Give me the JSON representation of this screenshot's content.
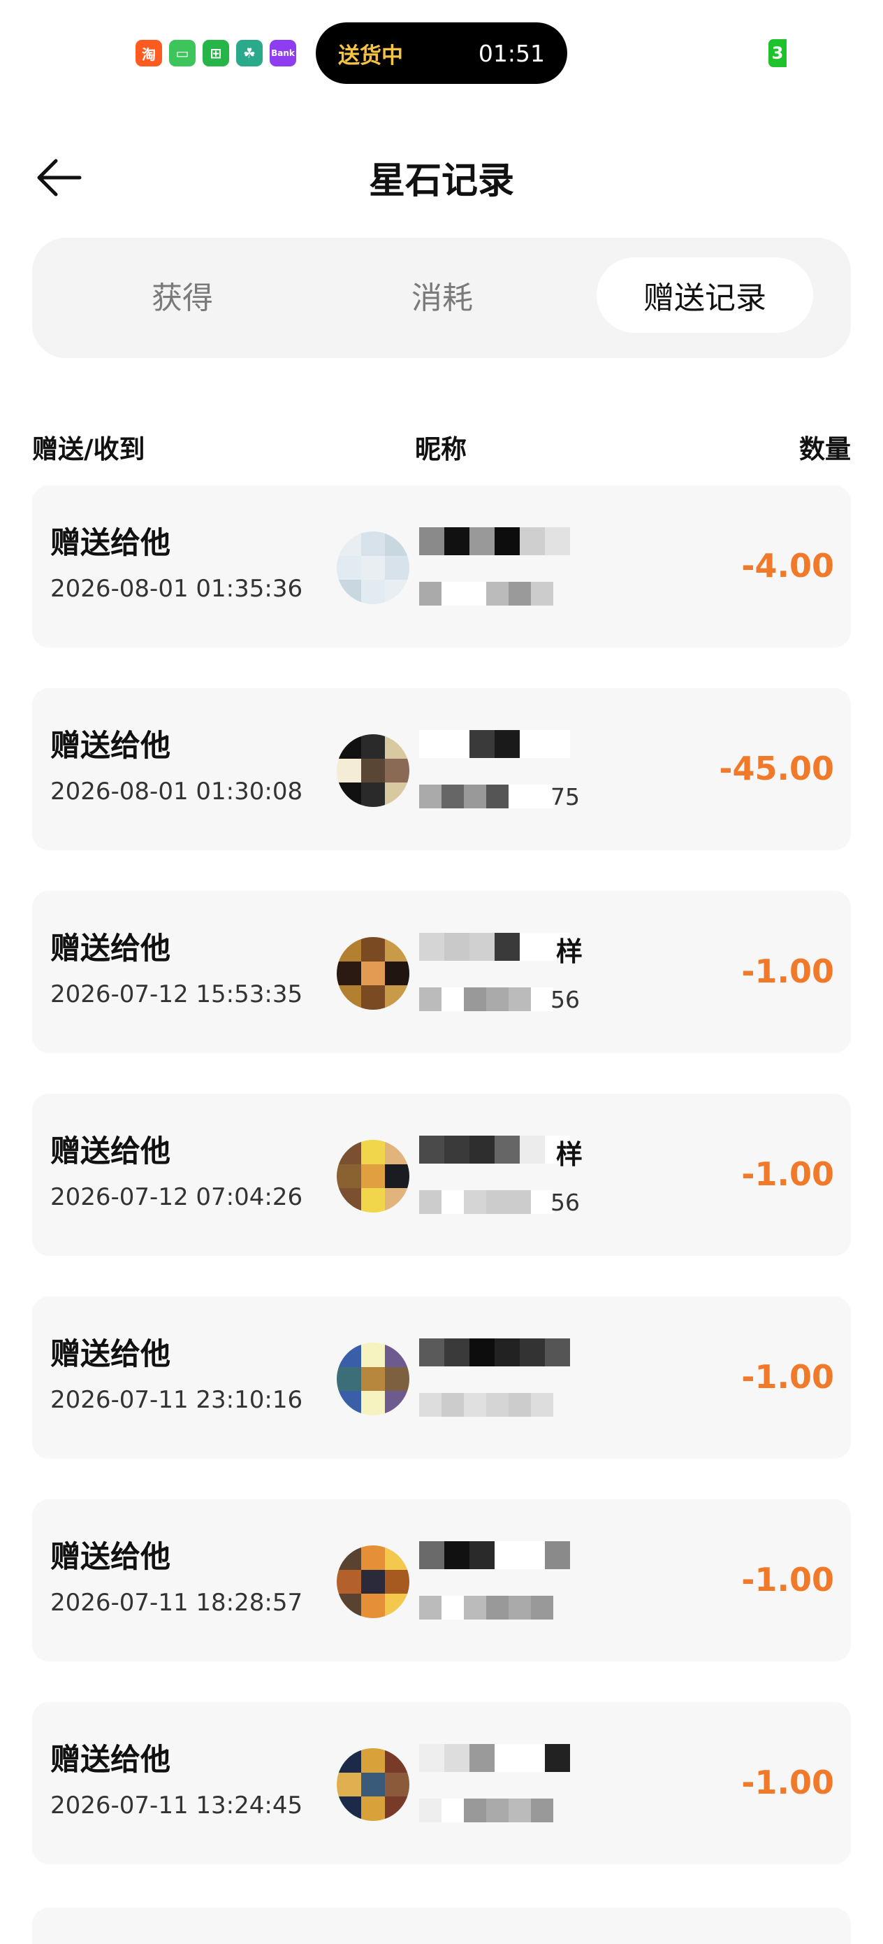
{
  "status_bar": {
    "app_icons": [
      {
        "glyph": "淘",
        "name": "taobao",
        "color": "#ff5a1f"
      },
      {
        "glyph": "▭",
        "name": "messages",
        "color": "#3dc45a"
      },
      {
        "glyph": "⊞",
        "name": "wallet",
        "color": "#26b548"
      },
      {
        "glyph": "☘",
        "name": "bank",
        "color": "#2aa98b"
      },
      {
        "glyph": "Bank",
        "name": "bank-app",
        "color": "#8e3df0"
      }
    ],
    "island_status": "送货中",
    "island_time": "01:51",
    "battery": "3",
    "colors": {
      "island_text": "#f6c445",
      "battery": "#1ec22b"
    }
  },
  "header": {
    "title": "星石记录",
    "back_icon": "arrow-left-icon"
  },
  "tabs": [
    {
      "label": "获得",
      "active": false
    },
    {
      "label": "消耗",
      "active": false
    },
    {
      "label": "赠送记录",
      "active": true
    }
  ],
  "columns": {
    "direction": "赠送/收到",
    "nickname": "昵称",
    "amount": "数量"
  },
  "records": [
    {
      "type": "赠送给他",
      "time": "2026-08-01 01:35:36",
      "nickname_suffix": "",
      "id_suffix": "",
      "amount": "-4.00"
    },
    {
      "type": "赠送给他",
      "time": "2026-08-01 01:30:08",
      "nickname_suffix": "",
      "id_suffix": "75",
      "amount": "-45.00"
    },
    {
      "type": "赠送给他",
      "time": "2026-07-12 15:53:35",
      "nickname_suffix": "样",
      "id_suffix": "56",
      "amount": "-1.00"
    },
    {
      "type": "赠送给他",
      "time": "2026-07-12 07:04:26",
      "nickname_suffix": "样",
      "id_suffix": "56",
      "amount": "-1.00"
    },
    {
      "type": "赠送给他",
      "time": "2026-07-11 23:10:16",
      "nickname_suffix": "",
      "id_suffix": "",
      "amount": "-1.00"
    },
    {
      "type": "赠送给他",
      "time": "2026-07-11 18:28:57",
      "nickname_suffix": "",
      "id_suffix": "",
      "amount": "-1.00"
    },
    {
      "type": "赠送给他",
      "time": "2026-07-11 13:24:45",
      "nickname_suffix": "",
      "id_suffix": "",
      "amount": "-1.00"
    }
  ],
  "colors": {
    "amount": "#f07a2a",
    "row_bg": "#f7f7f7",
    "tab_bg": "#f4f4f4"
  }
}
